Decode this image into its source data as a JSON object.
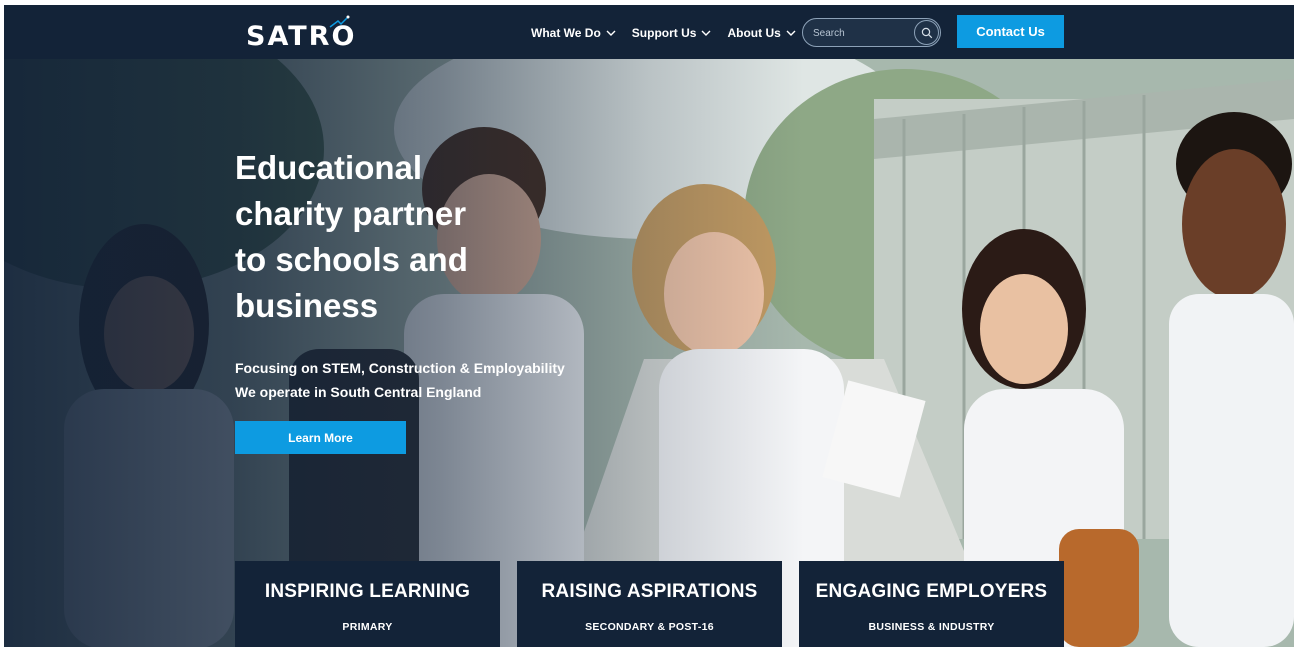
{
  "nav": {
    "logo_text": "SATRO",
    "menu": [
      {
        "label": "What We Do"
      },
      {
        "label": "Support Us"
      },
      {
        "label": "About Us"
      }
    ],
    "search_placeholder": "Search",
    "contact_label": "Contact Us"
  },
  "hero": {
    "headline_lines": [
      "Educational",
      "charity partner",
      "to schools and",
      "business"
    ],
    "sub_lines": [
      "Focusing on STEM, Construction & Employability",
      "We operate in South Central England"
    ],
    "cta_label": "Learn More"
  },
  "cards": [
    {
      "title": "INSPIRING LEARNING",
      "subtitle": "PRIMARY"
    },
    {
      "title": "RAISING ASPIRATIONS",
      "subtitle": "SECONDARY & POST-16"
    },
    {
      "title": "ENGAGING EMPLOYERS",
      "subtitle": "BUSINESS & INDUSTRY"
    }
  ],
  "colors": {
    "navy": "#132338",
    "accent_blue": "#0d9be1",
    "white": "#ffffff"
  },
  "icons": [
    "search-icon",
    "chevron-down-icon"
  ]
}
